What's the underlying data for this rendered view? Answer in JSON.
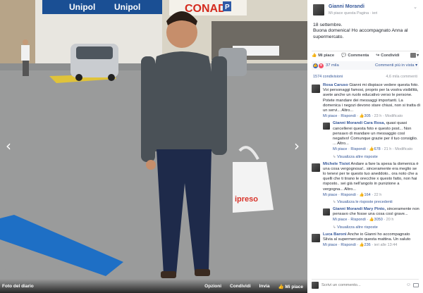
{
  "photo": {
    "album_label": "Foto del diario",
    "actions": [
      "Opzioni",
      "Condividi",
      "Invia",
      "Mi piace"
    ],
    "sign_texts": [
      "Unipol",
      "Unipol",
      "CONAD",
      "P"
    ],
    "bag_text": "ipreso"
  },
  "post": {
    "author": "Gianni Morandi",
    "meta": "Mi piace questa Pagina · ieri",
    "text": "18 settembre.\nBuona domenica! Ho accompagnato Anna al supermercato."
  },
  "actionbar": {
    "like": "Mi piace",
    "comment": "Commenta",
    "share": "Condividi"
  },
  "likes": {
    "count": "37 mila",
    "sort": "Commenti più in vista"
  },
  "shares": {
    "count": "1574 condivisioni",
    "views": "4,6 mila commenti"
  },
  "comments": [
    {
      "author": "Rosa Caruso",
      "text": "Gianni mi dispiace vedere questa foto. Voi personaggi famosi, proprio per la vostra visibilità, avete anche un ruolo educativo verso le persone. Potete mandare dei messaggi importanti. La domenica i negozi devono stare chiusi, non si tratta di un servi... Altro...",
      "like": "Mi piace",
      "reply": "Rispondi",
      "likes": "305",
      "time": "23 h",
      "edited": "Modificato"
    },
    {
      "author": "Gianni Morandi",
      "mention": "Cara Rosa,",
      "text": "quasi quasi cancellerei questa foto e questo post... Non pensavo di mandare un messaggio così negativo! Comunque grazie per il tuo consiglio. ... Altro...",
      "like": "Mi piace",
      "reply": "Rispondi",
      "likes": "678",
      "time": "21 h",
      "edited": "Modificato",
      "more": "Visualizza altre risposte"
    },
    {
      "author": "Michele Tisiot",
      "text": "Andare a fare la spesa la domenica è una cosa vergognosa!.. sinceramente era meglio se lo tenevi per te questo tuo aneddoto.. ora noto che a quelli che ti tirano le orecchie x questo fatto, non hai risposto.. sei già nell'angolo in punizione a vergogna... Altro...",
      "like": "Mi piace",
      "reply": "Rispondi",
      "likes": "164",
      "time": "22 h",
      "more": "Visualizza le risposte precedenti"
    },
    {
      "author": "Gianni Morandi",
      "mention": "Mary Pinto,",
      "text": "sinceramente non pensavo che fosse una cosa così grave...",
      "like": "Mi piace",
      "reply": "Rispondi",
      "likes": "3050",
      "time": "20 h",
      "more": "Visualizza altre risposte"
    },
    {
      "author": "Luca Baroni",
      "text": "Anche io Gianni ho accompagnato Silvia al supermercato questa mattina. Un saluto",
      "like": "Mi piace",
      "reply": "Rispondi",
      "likes": "236",
      "time": "ieri alle 13:44"
    }
  ],
  "comment_box": {
    "placeholder": "Scrivi un commento..."
  }
}
